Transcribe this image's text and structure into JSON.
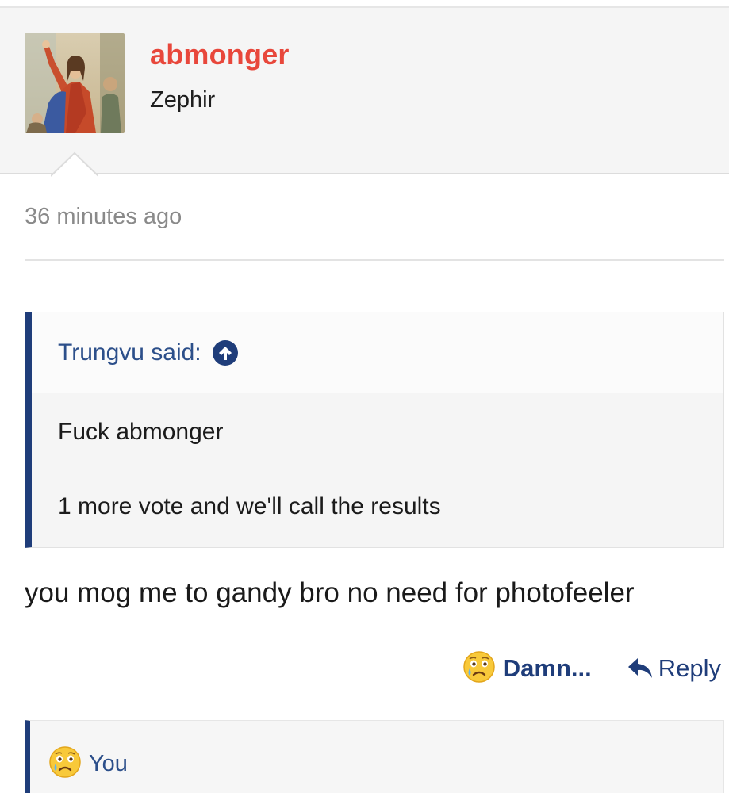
{
  "post": {
    "username": "abmonger",
    "user_title": "Zephir",
    "timestamp": "36 minutes ago",
    "message": "you mog me to gandy bro no need for photofeeler"
  },
  "quote": {
    "author": "Trungvu said:",
    "lines": [
      "Fuck abmonger",
      "1 more vote and we'll call the results"
    ]
  },
  "actions": {
    "reaction_label": "Damn...",
    "reply_label": "Reply"
  },
  "reactions": {
    "summary": "You"
  },
  "colors": {
    "username": "#e8473b",
    "accent": "#1f3d7a",
    "link": "#2c4f8a"
  },
  "icons": {
    "avatar": "painting-avatar",
    "quote_jump": "arrow-up-circle-icon",
    "reaction": "sad-tear-emoji-icon",
    "reply": "reply-arrow-icon"
  }
}
